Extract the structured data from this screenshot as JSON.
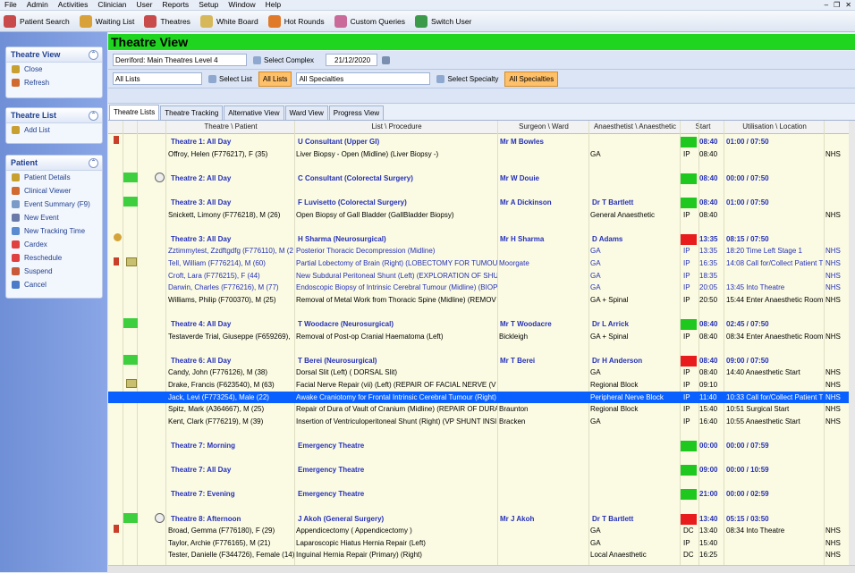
{
  "menu": [
    "File",
    "Admin",
    "Activities",
    "Clinician",
    "User",
    "Reports",
    "Setup",
    "Window",
    "Help"
  ],
  "toolbar": [
    {
      "label": "Patient Search",
      "icon": "patient-search-icon",
      "color": "#c94a4a"
    },
    {
      "label": "Waiting List",
      "icon": "clock-icon",
      "color": "#d8a13a"
    },
    {
      "label": "Theatres",
      "icon": "theatres-icon",
      "color": "#c94a4a"
    },
    {
      "label": "White Board",
      "icon": "whiteboard-icon",
      "color": "#d6b85a"
    },
    {
      "label": "Hot Rounds",
      "icon": "hot-rounds-icon",
      "color": "#e07a2a"
    },
    {
      "label": "Custom Queries",
      "icon": "custom-queries-icon",
      "color": "#c96a9a"
    },
    {
      "label": "Switch User",
      "icon": "switch-user-icon",
      "color": "#3a9a4a"
    }
  ],
  "sidebar": {
    "theatre_view": {
      "title": "Theatre View",
      "items": [
        {
          "label": "Close",
          "icon": "close-icon"
        },
        {
          "label": "Refresh",
          "icon": "refresh-icon"
        }
      ]
    },
    "theatre_list": {
      "title": "Theatre List",
      "items": [
        {
          "label": "Add List",
          "icon": "add-list-icon"
        }
      ]
    },
    "patient": {
      "title": "Patient",
      "items": [
        {
          "label": "Patient Details",
          "icon": "patient-details-icon"
        },
        {
          "label": "Clinical Viewer",
          "icon": "clinical-viewer-icon"
        },
        {
          "label": "Event Summary (F9)",
          "icon": "event-summary-icon"
        },
        {
          "label": "New Event",
          "icon": "new-event-icon"
        },
        {
          "label": "New Tracking Time",
          "icon": "tracking-time-icon"
        },
        {
          "label": "Cardex",
          "icon": "cardex-icon"
        },
        {
          "label": "Reschedule",
          "icon": "reschedule-icon"
        },
        {
          "label": "Suspend",
          "icon": "suspend-icon"
        },
        {
          "label": "Cancel",
          "icon": "cancel-icon"
        }
      ]
    }
  },
  "main": {
    "title": "Theatre View",
    "complex_value": "Derriford: Main Theatres Level 4",
    "select_complex": "Select Complex",
    "date": "21/12/2020",
    "list_value": "All Lists",
    "select_list": "Select List",
    "all_lists_btn": "All Lists",
    "specialty_value": "All Specialties",
    "select_specialty": "Select Specialty",
    "all_specialties_btn": "All Specialties",
    "tabs": [
      "Theatre Lists",
      "Theatre Tracking",
      "Alternative View",
      "Ward View",
      "Progress View"
    ],
    "columns": [
      "Theatre \\ Patient",
      "List \\ Procedure",
      "Surgeon \\ Ward",
      "Anaesthetist \\ Anaesthetic",
      "Start",
      "Utilisation \\ Location"
    ]
  },
  "rows": [
    {
      "t": "h",
      "i1": "flag",
      "theatre": "Theatre 1: All Day",
      "list": "U Consultant (Upper GI)",
      "surgeon": "Mr M Bowles",
      "anaes": "",
      "status": "#1ec81e",
      "time": "08:40",
      "util": "01:00 / 07:50",
      "loc": ""
    },
    {
      "t": "p",
      "i1": "",
      "patient": "Offroy, Helen (F776217), F (35)",
      "proc": "Liver Biopsy - Open (Midline) (Liver Biopsy -)",
      "ward": "",
      "anaes": "GA",
      "code": "IP",
      "start": "08:40",
      "util": "",
      "loc": "NHS"
    },
    {
      "t": "g"
    },
    {
      "t": "h",
      "i1": "green",
      "i2": "cd",
      "theatre": "Theatre 2: All Day",
      "list": "C Consultant (Colorectal Surgery)",
      "surgeon": "Mr W Douie",
      "anaes": "",
      "status": "#1ec81e",
      "time": "08:40",
      "util": "00:00 / 07:50",
      "loc": ""
    },
    {
      "t": "g"
    },
    {
      "t": "h",
      "i1": "green",
      "theatre": "Theatre 3: All Day",
      "list": "F Luvisetto (Colorectal Surgery)",
      "surgeon": "Mr A Dickinson",
      "anaes": "Dr T Bartlett",
      "status": "#1ec81e",
      "time": "08:40",
      "util": "01:00 / 07:50",
      "loc": ""
    },
    {
      "t": "p",
      "patient": "Snickett, Limony (F776218), M (26)",
      "proc": "Open Biopsy of Gall Bladder (GallBladder Biopsy)",
      "ward": "",
      "anaes": "General Anaesthetic",
      "code": "IP",
      "start": "08:40",
      "util": "",
      "loc": "NHS"
    },
    {
      "t": "g"
    },
    {
      "t": "h",
      "i1": "clock",
      "theatre": "Theatre 3: All Day",
      "list": "H Sharma (Neurosurgical)",
      "surgeon": "Mr H Sharma",
      "anaes": "D Adams",
      "status": "#e81c1c",
      "time": "13:35",
      "util": "08:15 / 07:50",
      "loc": ""
    },
    {
      "t": "p",
      "c": "blu",
      "patient": "Zztimmytest, Zzdftgdfg (F776110), M (2",
      "proc": "Posterior Thoracic Decompression (Midline)",
      "ward": "",
      "anaes": "GA",
      "code": "IP",
      "start": "13:35",
      "util": "18:20  Time Left Stage 1",
      "loc": "NHS"
    },
    {
      "t": "p",
      "c": "blu",
      "i1": "flag",
      "i2": "note",
      "patient": "Tell, William (F776214), M (60)",
      "proc": "Partial Lobectomy of Brain (Right) (LOBECTOMY FOR TUMOU",
      "ward": "Moorgate",
      "anaes": "GA",
      "code": "IP",
      "start": "16:35",
      "util": "14:08  Call for/Collect Patient T",
      "loc": "NHS"
    },
    {
      "t": "p",
      "c": "blu",
      "patient": "Croft, Lara (F776215), F (44)",
      "proc": "New Subdural Peritoneal Shunt (Left) (EXPLORATION OF SHU",
      "ward": "",
      "anaes": "GA",
      "code": "IP",
      "start": "18:35",
      "util": "",
      "loc": "NHS"
    },
    {
      "t": "p",
      "c": "blu",
      "patient": "Darwin, Charles (F776216), M (77)",
      "proc": "Endoscopic Biopsy of Intrinsic Cerebral Tumour (Midline) (BIOPS",
      "ward": "",
      "anaes": "GA",
      "code": "IP",
      "start": "20:05",
      "util": "13:45  Into Theatre",
      "loc": "NHS"
    },
    {
      "t": "p",
      "patient": "Williams, Philip (F700370), M (25)",
      "proc": "Removal of Metal Work from Thoracic Spine (Midline) (REMOV",
      "ward": "",
      "anaes": "GA + Spinal",
      "code": "IP",
      "start": "20:50",
      "util": "15:44  Enter Anaesthetic Room",
      "loc": "NHS"
    },
    {
      "t": "g"
    },
    {
      "t": "h",
      "i1": "green",
      "theatre": "Theatre 4: All Day",
      "list": "T Woodacre (Neurosurgical)",
      "surgeon": "Mr T Woodacre",
      "anaes": "Dr L Arrick",
      "status": "#1ec81e",
      "time": "08:40",
      "util": "02:45 / 07:50",
      "loc": ""
    },
    {
      "t": "p",
      "patient": "Testaverde Trial, Giuseppe (F659269),",
      "proc": "Removal of Post-op Cranial Haematoma (Left)",
      "ward": "Bickleigh",
      "anaes": "GA + Spinal",
      "code": "IP",
      "start": "08:40",
      "util": "08:34  Enter Anaesthetic Room",
      "loc": "NHS"
    },
    {
      "t": "g"
    },
    {
      "t": "h",
      "i1": "green",
      "theatre": "Theatre 6: All Day",
      "list": "T Berei (Neurosurgical)",
      "surgeon": "Mr T Berei",
      "anaes": "Dr H Anderson",
      "status": "#e81c1c",
      "time": "08:40",
      "util": "09:00 / 07:50",
      "loc": ""
    },
    {
      "t": "p",
      "patient": "Candy, John (F776126), M (38)",
      "proc": "Dorsal Slit (Left) ( DORSAL Slit)",
      "ward": "",
      "anaes": "GA",
      "code": "IP",
      "start": "08:40",
      "util": "14:40  Anaesthetic Start",
      "loc": "NHS"
    },
    {
      "t": "p",
      "i2": "note",
      "patient": "Drake, Francis (F623540), M (63)",
      "proc": "Facial Nerve Repair (vii) (Left) (REPAIR OF FACIAL NERVE (V",
      "ward": "",
      "anaes": "Regional Block",
      "code": "IP",
      "start": "09:10",
      "util": "",
      "loc": "NHS"
    },
    {
      "t": "p",
      "c": "sel",
      "patient": "Jack, Levi (F773254), Male (22)",
      "proc": "Awake Craniotomy for Frontal Intrinsic Cerebral Tumour (Right) (",
      "ward": "",
      "anaes": "Peripheral Nerve Block",
      "code": "IP",
      "start": "11:40",
      "util": "10:33  Call for/Collect Patient T",
      "loc": "NHS"
    },
    {
      "t": "p",
      "patient": "Spitz, Mark (A364667), M (25)",
      "proc": "Repair of Dura of Vault of Cranium (Midline) (REPAIR OF DURA",
      "ward": "Braunton",
      "anaes": "Regional Block",
      "code": "IP",
      "start": "15:40",
      "util": "10:51  Surgical Start",
      "loc": "NHS"
    },
    {
      "t": "p",
      "patient": "Kent, Clark (F776219), M (39)",
      "proc": "Insertion of Ventriculoperitoneal Shunt (Right) (VP SHUNT INSI",
      "ward": "Bracken",
      "anaes": "GA",
      "code": "IP",
      "start": "16:40",
      "util": "10:55  Anaesthetic Start",
      "loc": "NHS"
    },
    {
      "t": "g"
    },
    {
      "t": "h",
      "theatre": "Theatre 7: Morning",
      "list": "Emergency Theatre",
      "surgeon": "",
      "anaes": "",
      "status": "#1ec81e",
      "time": "00:00",
      "util": "00:00 / 07:59",
      "loc": ""
    },
    {
      "t": "g"
    },
    {
      "t": "h",
      "theatre": "Theatre 7: All Day",
      "list": "Emergency Theatre",
      "surgeon": "",
      "anaes": "",
      "status": "#1ec81e",
      "time": "09:00",
      "util": "00:00 / 10:59",
      "loc": ""
    },
    {
      "t": "g"
    },
    {
      "t": "h",
      "theatre": "Theatre 7: Evening",
      "list": "Emergency Theatre",
      "surgeon": "",
      "anaes": "",
      "status": "#1ec81e",
      "time": "21:00",
      "util": "00:00 / 02:59",
      "loc": ""
    },
    {
      "t": "g"
    },
    {
      "t": "h",
      "i1": "green",
      "i2": "cd",
      "theatre": "Theatre 8: Afternoon",
      "list": "J Akoh (General Surgery)",
      "surgeon": "Mr J Akoh",
      "anaes": "Dr T Bartlett",
      "status": "#e81c1c",
      "time": "13:40",
      "util": "05:15 / 03:50",
      "loc": ""
    },
    {
      "t": "p",
      "i1": "flag",
      "patient": "Broad, Gemma (F776180), F (29)",
      "proc": "Appendicectomy ( Appendicectomy )",
      "ward": "",
      "anaes": "GA",
      "code": "DC",
      "start": "13:40",
      "util": "08:34  Into Theatre",
      "loc": "NHS"
    },
    {
      "t": "p",
      "patient": "Taylor, Archie (F776165), M (21)",
      "proc": "Laparoscopic Hiatus Hernia Repair (Left)",
      "ward": "",
      "anaes": "GA",
      "code": "IP",
      "start": "15:40",
      "util": "",
      "loc": "NHS"
    },
    {
      "t": "p",
      "patient": "Tester, Danielle (F344726), Female (14)",
      "proc": "Inguinal Hernia Repair (Primary) (Right)",
      "ward": "",
      "anaes": "Local Anaesthetic",
      "code": "DC",
      "start": "16:25",
      "util": "",
      "loc": "NHS"
    }
  ]
}
